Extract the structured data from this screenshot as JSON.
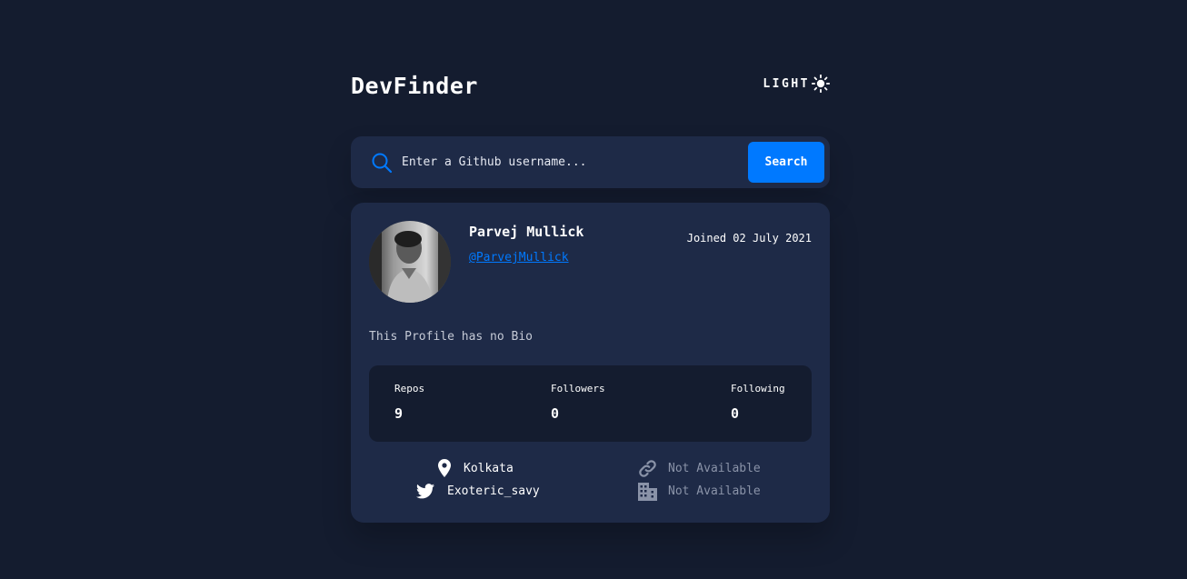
{
  "header": {
    "brand": "DevFinder",
    "theme_toggle_label": "LIGHT",
    "theme_icon": "sun-icon"
  },
  "search": {
    "placeholder": "Enter a Github username...",
    "value": "",
    "button_label": "Search",
    "icon": "search-icon"
  },
  "profile": {
    "name": "Parvej Mullick",
    "handle": "@ParvejMullick",
    "joined": "Joined 02 July 2021",
    "bio": "This Profile has no Bio",
    "stats": [
      {
        "label": "Repos",
        "value": "9"
      },
      {
        "label": "Followers",
        "value": "0"
      },
      {
        "label": "Following",
        "value": "0"
      }
    ],
    "links": {
      "location": {
        "icon": "location-pin-icon",
        "text": "Kolkata"
      },
      "twitter": {
        "icon": "twitter-icon",
        "text": "Exoteric_savy"
      },
      "website": {
        "icon": "link-icon",
        "text": "Not Available"
      },
      "company": {
        "icon": "building-icon",
        "text": "Not Available"
      }
    }
  },
  "colors": {
    "background": "#141c2f",
    "card": "#1e2a47",
    "accent": "#0079ff",
    "muted": "#8a93a8"
  }
}
